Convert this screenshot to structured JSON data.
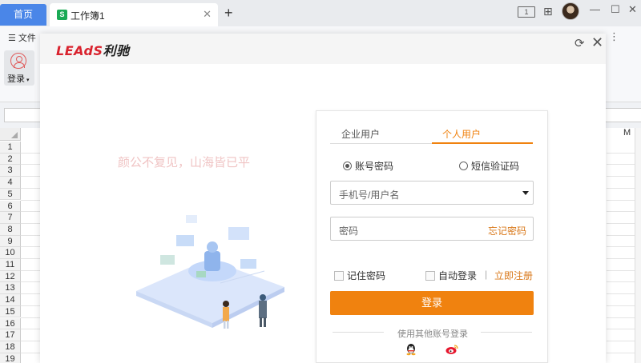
{
  "titlebar": {
    "home_tab": "首页",
    "doc_tab": "工作簿1",
    "doc_icon": "S",
    "num_indicator": "1"
  },
  "ribbon": {
    "file_menu": "文件",
    "login_label": "登录"
  },
  "sheet": {
    "rows": [
      "1",
      "2",
      "3",
      "4",
      "5",
      "6",
      "7",
      "8",
      "9",
      "10",
      "11",
      "12",
      "13",
      "14",
      "15",
      "16",
      "17",
      "18",
      "19"
    ],
    "col_right": "M"
  },
  "modal": {
    "logo_part1": "LEAdS",
    "logo_part2": "利驰",
    "watermark": "颜公不复见，山海皆已平"
  },
  "login": {
    "tab_enterprise": "企业用户",
    "tab_personal": "个人用户",
    "radio_password": "账号密码",
    "radio_sms": "短信验证码",
    "username_placeholder": "手机号/用户名",
    "password_placeholder": "密码",
    "forgot_password": "忘记密码",
    "remember_password": "记住密码",
    "auto_login": "自动登录",
    "separator": "|",
    "register": "立即注册",
    "login_button": "登录",
    "other_accounts": "使用其他账号登录"
  },
  "colors": {
    "accent": "#f0820f",
    "tab_blue": "#4a86e8",
    "brand_red": "#d9232e",
    "green": "#1aaa55"
  },
  "icons": [
    "doc-s-icon",
    "close-icon",
    "plus-icon",
    "layout-icon",
    "grid-icon",
    "avatar",
    "minimize-icon",
    "maximize-icon",
    "window-close-icon",
    "menu-icon",
    "user-login-icon",
    "refresh-icon",
    "qq-icon",
    "weibo-icon"
  ]
}
